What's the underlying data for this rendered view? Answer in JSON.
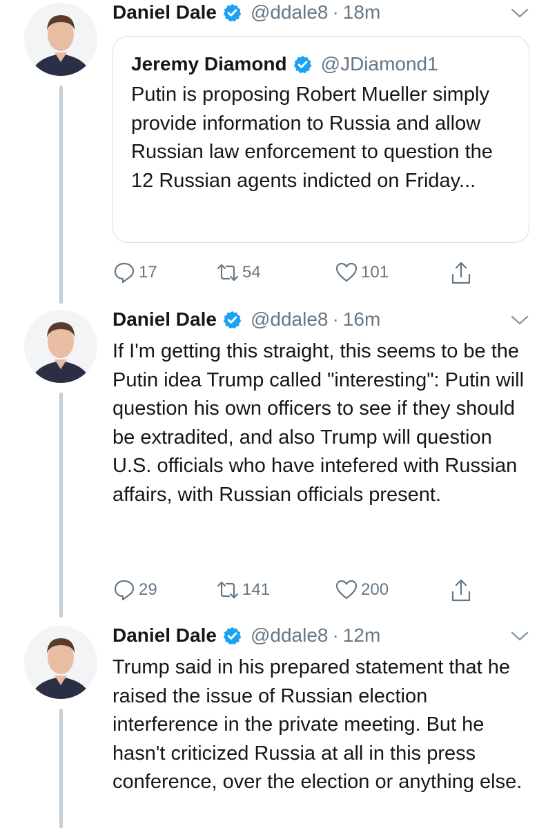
{
  "tweets": [
    {
      "name": "Daniel Dale",
      "handle": "@ddale8",
      "time": "18m",
      "quote": {
        "name": "Jeremy Diamond",
        "handle": "@JDiamond1",
        "text": "Putin is proposing Robert Mueller simply provide information to Russia and allow Russian law enforcement to question the 12 Russian agents indicted on Friday..."
      },
      "replies": "17",
      "retweets": "54",
      "likes": "101"
    },
    {
      "name": "Daniel Dale",
      "handle": "@ddale8",
      "time": "16m",
      "text": "If I'm getting this straight, this seems to be the Putin idea Trump called \"interesting\": Putin will question his own officers to see if they should be extradited, and also Trump will question U.S. officials who have intefered with Russian affairs, with Russian officials present.",
      "replies": "29",
      "retweets": "141",
      "likes": "200"
    },
    {
      "name": "Daniel Dale",
      "handle": "@ddale8",
      "time": "12m",
      "text": "Trump said in his prepared statement that he raised the issue of Russian election interference in the private meeting. But he hasn't criticized Russia at all in this press conference, over the election or anything else."
    }
  ],
  "separator": "·",
  "colors": {
    "verified": "#1da1f2",
    "secondary_text": "#657786",
    "thread_line": "#c4cfd6"
  },
  "icons": {
    "reply": "reply-icon",
    "retweet": "retweet-icon",
    "like": "heart-icon",
    "share": "share-icon",
    "menu": "chevron-down-icon",
    "verified": "verified-badge-icon"
  }
}
